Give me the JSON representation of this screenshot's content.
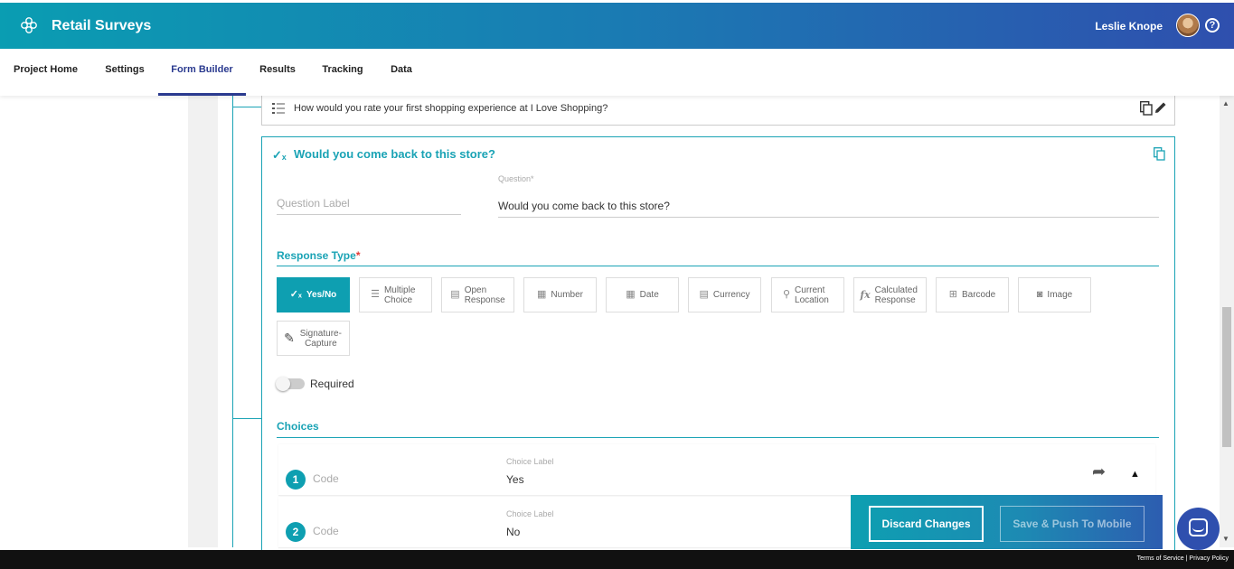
{
  "header": {
    "app_title": "Retail Surveys",
    "user_name": "Leslie Knope",
    "help_glyph": "?",
    "logo_icon": "flower-logo-icon"
  },
  "nav": {
    "items": [
      {
        "label": "Project Home"
      },
      {
        "label": "Settings"
      },
      {
        "label": "Form Builder",
        "active": true
      },
      {
        "label": "Results"
      },
      {
        "label": "Tracking"
      },
      {
        "label": "Data"
      }
    ]
  },
  "previous_question": {
    "text": "How would you rate your first shopping experience at I Love Shopping?",
    "icon": "list-icon"
  },
  "question_card": {
    "title": "Would you come back to this store?",
    "label_placeholder": "Question Label",
    "question_field_label": "Question*",
    "question_value": "Would you come back to this store?"
  },
  "response_type": {
    "title": "Response Type",
    "required_mark": "*",
    "options": [
      {
        "label": "Yes/No",
        "icon": "yes-no-icon",
        "glyph": "✓ₓ",
        "active": true
      },
      {
        "label": "Multiple Choice",
        "icon": "multiple-choice-icon",
        "glyph": "☰"
      },
      {
        "label": "Open Response",
        "icon": "open-response-icon",
        "glyph": "▤"
      },
      {
        "label": "Number",
        "icon": "number-icon",
        "glyph": "▦"
      },
      {
        "label": "Date",
        "icon": "calendar-icon",
        "glyph": "▦"
      },
      {
        "label": "Currency",
        "icon": "currency-icon",
        "glyph": "▤"
      },
      {
        "label": "Current Location",
        "icon": "location-pin-icon",
        "glyph": "⚲"
      },
      {
        "label": "Calculated Response",
        "icon": "function-icon",
        "glyph": "fx"
      },
      {
        "label": "Barcode",
        "icon": "barcode-icon",
        "glyph": "⊞"
      },
      {
        "label": "Image",
        "icon": "camera-icon",
        "glyph": "◙"
      },
      {
        "label": "Signature-Capture",
        "icon": "pen-icon",
        "glyph": "✎"
      }
    ]
  },
  "required": {
    "label": "Required",
    "enabled": false
  },
  "choices": {
    "title": "Choices",
    "items": [
      {
        "number": "1",
        "code_placeholder": "Code",
        "label_caption": "Choice Label",
        "value": "Yes"
      },
      {
        "number": "2",
        "code_placeholder": "Code",
        "label_caption": "Choice Label",
        "value": "No"
      }
    ]
  },
  "actions": {
    "discard": "Discard Changes",
    "save": "Save & Push To Mobile"
  },
  "footer": {
    "terms": "Terms of Service",
    "separator": "|",
    "privacy": "Privacy Policy"
  },
  "colors": {
    "accent": "#0e9fb1",
    "nav_active": "#2a3a8f",
    "header_start": "#0a9db2",
    "header_end": "#2f4fae"
  }
}
